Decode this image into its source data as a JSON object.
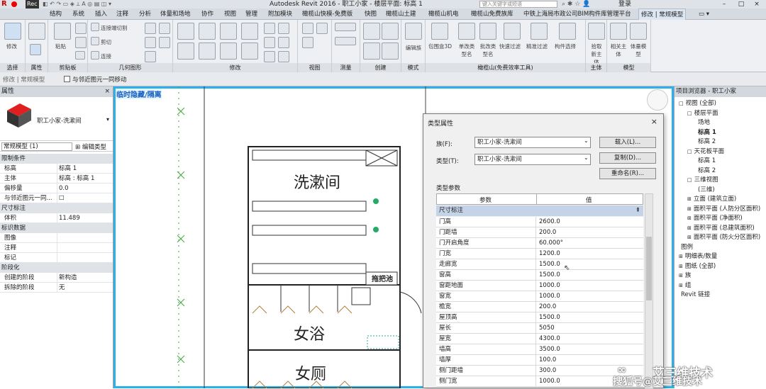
{
  "titlebar": {
    "title": "Autodesk Revit 2016 -   职工小家 - 楼层平面: 标高 1",
    "search_placeholder": "键入关键字或短语",
    "user": "登录",
    "rec": "Rec"
  },
  "tabs": [
    "结构",
    "系统",
    "插入",
    "注释",
    "分析",
    "体量和场地",
    "协作",
    "视图",
    "管理",
    "附加模块",
    "橄榄山快模-免费版",
    "快图",
    "橄榄山土建",
    "橄榄山机电",
    "橄榄山免费族库",
    "中铁上海局市政公司BIM构件库管理平台",
    "修改 | 常规模型"
  ],
  "ribbon": {
    "panels": [
      "选择",
      "属性",
      "剪贴板",
      "几何图形",
      "修改",
      "视图",
      "测量",
      "创建",
      "模式",
      "橄榄山(免费效率工具)",
      "主体",
      "模型"
    ],
    "labels": {
      "modify": "修改",
      "paste": "粘贴",
      "connect": "连接端切割",
      "cut": "剪切",
      "join": "连接",
      "edit_family": "编辑族",
      "bbox3d": "包围盒3D",
      "single_type": "单改类型名",
      "batch_type": "批改类型名",
      "quick_filter": "快速过滤",
      "precise_filter": "精准过滤",
      "member_filter": "构件选择",
      "pick_host": "拾取新主体",
      "host": "相关主体",
      "model": "体量模型"
    }
  },
  "options_bar": {
    "mode": "修改 | 常规模型",
    "checkbox_label": "与邻近图元一同移动"
  },
  "properties": {
    "title": "属性",
    "family_name": "职工小家-洗漱间",
    "selector": "常规模型 (1)",
    "edit_type": "编辑类型",
    "groups": [
      {
        "name": "限制条件",
        "rows": [
          [
            "标高",
            "标高 1"
          ],
          [
            "主体",
            "标高 : 标高 1"
          ],
          [
            "偏移量",
            "0.0"
          ],
          [
            "与邻近图元一同...",
            "☐"
          ]
        ]
      },
      {
        "name": "尺寸标注",
        "rows": [
          [
            "体积",
            "11.489"
          ]
        ]
      },
      {
        "name": "标识数据",
        "rows": [
          [
            "图像",
            ""
          ],
          [
            "注释",
            ""
          ],
          [
            "标记",
            ""
          ]
        ]
      },
      {
        "name": "阶段化",
        "rows": [
          [
            "创建的阶段",
            "新构造"
          ],
          [
            "拆除的阶段",
            "无"
          ]
        ]
      }
    ]
  },
  "canvas": {
    "banner": "临时隐藏/隔离",
    "rooms": [
      "洗漱间",
      "女浴",
      "女厕"
    ],
    "tag": "拖把池"
  },
  "dialog": {
    "title": "类型属性",
    "family_label": "族(F):",
    "family_value": "职工小家-洗漱间",
    "type_label": "类型(T):",
    "type_value": "职工小家-洗漱间",
    "load_button": "载入(L)...",
    "duplicate_button": "复制(D)...",
    "rename_button": "重命名(R)...",
    "params_label": "类型参数",
    "col_param": "参数",
    "col_value": "值",
    "group": "尺寸标注",
    "rows": [
      [
        "门高",
        "2600.0"
      ],
      [
        "门距墙",
        "200.0"
      ],
      [
        "门开启角度",
        "60.000°"
      ],
      [
        "门宽",
        "1200.0"
      ],
      [
        "走廊宽",
        "1500.0"
      ],
      [
        "窗高",
        "1500.0"
      ],
      [
        "窗距地面",
        "1000.0"
      ],
      [
        "窗宽",
        "1000.0"
      ],
      [
        "檐宽",
        "200.0"
      ],
      [
        "屋顶高",
        "1500.0"
      ],
      [
        "屋长",
        "5050"
      ],
      [
        "屋宽",
        "4300.0"
      ],
      [
        "墙高",
        "3500.0"
      ],
      [
        "墙厚",
        "100.0"
      ],
      [
        "侧门距墙",
        "300.0"
      ],
      [
        "侧门宽",
        "1000.0"
      ]
    ]
  },
  "browser": {
    "title": "项目浏览器 - 职工小家",
    "items": [
      {
        "label": "视图 (全部)",
        "indent": 0,
        "sign": "□"
      },
      {
        "label": "楼层平面",
        "indent": 1,
        "sign": "□"
      },
      {
        "label": "场地",
        "indent": 2,
        "sign": ""
      },
      {
        "label": "标高 1",
        "indent": 2,
        "sign": "",
        "bold": true
      },
      {
        "label": "标高 2",
        "indent": 2,
        "sign": ""
      },
      {
        "label": "天花板平面",
        "indent": 1,
        "sign": "□"
      },
      {
        "label": "标高 1",
        "indent": 2,
        "sign": ""
      },
      {
        "label": "标高 2",
        "indent": 2,
        "sign": ""
      },
      {
        "label": "三维视图",
        "indent": 1,
        "sign": "□"
      },
      {
        "label": "(三维)",
        "indent": 2,
        "sign": ""
      },
      {
        "label": "立面 (建筑立面)",
        "indent": 1,
        "sign": "⊞"
      },
      {
        "label": "面积平面 (人防分区面积)",
        "indent": 1,
        "sign": "⊞"
      },
      {
        "label": "面积平面 (净面积)",
        "indent": 1,
        "sign": "⊞"
      },
      {
        "label": "面积平面 (总建筑面积)",
        "indent": 1,
        "sign": "⊞"
      },
      {
        "label": "面积平面 (防火分区面积)",
        "indent": 1,
        "sign": "⊞"
      },
      {
        "label": "图例",
        "indent": 0,
        "sign": ""
      },
      {
        "label": "明细表/数量",
        "indent": 0,
        "sign": "⊞"
      },
      {
        "label": "图纸 (全部)",
        "indent": 0,
        "sign": "⊞"
      },
      {
        "label": "族",
        "indent": 0,
        "sign": "⊞"
      },
      {
        "label": "组",
        "indent": 0,
        "sign": "⊞"
      },
      {
        "label": "Revit 链接",
        "indent": 0,
        "sign": ""
      }
    ]
  },
  "watermark": {
    "line1": "艾三维技术",
    "line2": "搜狐号@艾三维技术"
  }
}
